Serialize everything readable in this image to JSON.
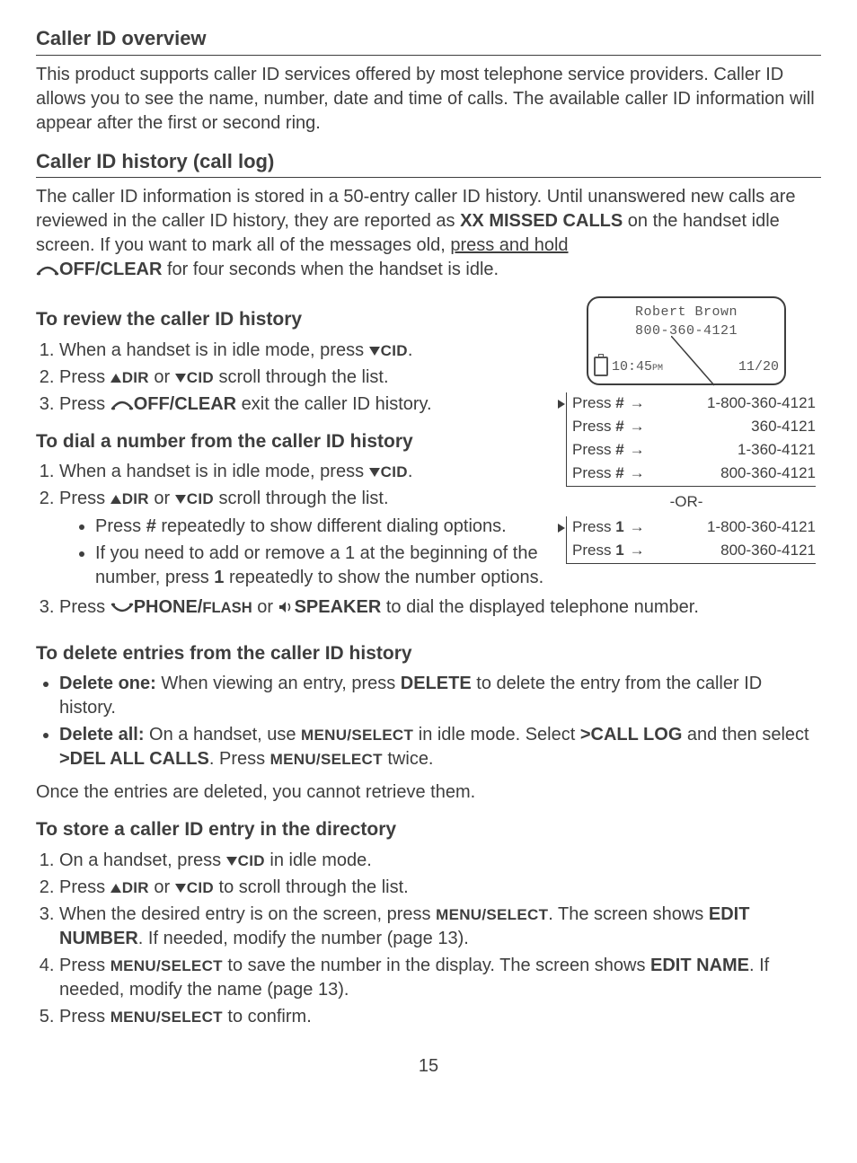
{
  "section1": {
    "title": "Caller ID overview",
    "body": "This product supports caller ID services offered by most telephone service providers. Caller ID allows you to see the name, number, date and time of calls. The available caller ID information will appear after the first or second ring."
  },
  "section2": {
    "title": "Caller ID history (call log)",
    "body_a": "The caller ID information is stored in a 50-entry caller ID history. Until unanswered new calls are reviewed in the caller ID history, they are reported as ",
    "body_b": "XX MISSED CALLS",
    "body_c": " on the handset idle screen. If you want to mark all of the messages old, ",
    "body_d": "press and hold",
    "body_e": "OFF/CLEAR",
    "body_f": " for four seconds when the handset is idle."
  },
  "lcd": {
    "name": "Robert Brown",
    "number": "800-360-4121",
    "time": "10:45",
    "ampm": "PM",
    "date": "11/20"
  },
  "cycle_hash": [
    {
      "label_pre": "Press ",
      "key": "#",
      "num": "1-800-360-4121"
    },
    {
      "label_pre": "Press ",
      "key": "#",
      "num": "360-4121"
    },
    {
      "label_pre": "Press ",
      "key": "#",
      "num": "1-360-4121"
    },
    {
      "label_pre": "Press ",
      "key": "#",
      "num": "800-360-4121"
    }
  ],
  "or_label": "-OR-",
  "cycle_one": [
    {
      "label_pre": "Press ",
      "key": "1",
      "num": "1-800-360-4121"
    },
    {
      "label_pre": "Press ",
      "key": "1",
      "num": "800-360-4121"
    }
  ],
  "review": {
    "title": "To review the caller ID history",
    "s1_a": "When a handset is in idle mode, press ",
    "s1_key": "CID",
    "s1_b": ".",
    "s2_a": "Press ",
    "s2_k1": "DIR",
    "s2_mid": " or ",
    "s2_k2": "CID",
    "s2_b": " scroll through the list.",
    "s3_a": "Press ",
    "s3_key": "OFF/CLEAR",
    "s3_b": " exit the caller ID history."
  },
  "dial": {
    "title": "To dial a number from the caller ID history",
    "s1_a": "When a handset is in idle mode, press ",
    "s1_key": "CID",
    "s1_b": ".",
    "s2_a": "Press ",
    "s2_k1": "DIR",
    "s2_mid": " or ",
    "s2_k2": "CID",
    "s2_b": " scroll through the list.",
    "b1_a": "Press ",
    "b1_key": "#",
    "b1_b": " repeatedly to show different dialing options.",
    "b2_a": "If you need to add or remove a 1 at the beginning of the number, press ",
    "b2_key": "1",
    "b2_b": " repeatedly to show the number options.",
    "s3_a": "Press ",
    "s3_k1": "PHONE/",
    "s3_k1b": "FLASH",
    "s3_mid": " or ",
    "s3_k2": "SPEAKER",
    "s3_b": " to dial the displayed telephone number."
  },
  "delete": {
    "title": "To delete entries from the caller ID history",
    "d1_a": "Delete one:",
    "d1_b": " When viewing an entry, press ",
    "d1_key": "DELETE",
    "d1_c": " to delete the entry from the caller ID history.",
    "d2_a": "Delete all:",
    "d2_b": " On a handset, use ",
    "d2_k1": "MENU/SELECT",
    "d2_c": " in idle mode. Select ",
    "d2_k2": ">CALL LOG",
    "d2_d": " and then select ",
    "d2_k3": ">DEL ALL CALLS",
    "d2_e": ". Press ",
    "d2_k4": "MENU/SELECT",
    "d2_f": " twice.",
    "note": "Once the entries are deleted, you cannot retrieve them."
  },
  "store": {
    "title": "To store a caller ID entry in the directory",
    "s1_a": "On a handset, press ",
    "s1_key": "CID",
    "s1_b": " in idle mode.",
    "s2_a": "Press ",
    "s2_k1": "DIR",
    "s2_mid": " or ",
    "s2_k2": "CID",
    "s2_b": " to scroll through the list.",
    "s3_a": "When the desired entry is on the screen, press ",
    "s3_k1": "MENU/SELECT",
    "s3_b": ". The screen shows ",
    "s3_k2": "EDIT NUMBER",
    "s3_c": ". If needed, modify the number (page 13).",
    "s4_a": "Press ",
    "s4_k1": "MENU/SELECT",
    "s4_b": " to save the number in the display. The screen shows ",
    "s4_k2": "EDIT NAME",
    "s4_c": ". If needed, modify the name (page 13).",
    "s5_a": "Press ",
    "s5_k1": "MENU/SELECT",
    "s5_b": " to confirm."
  },
  "page": "15"
}
